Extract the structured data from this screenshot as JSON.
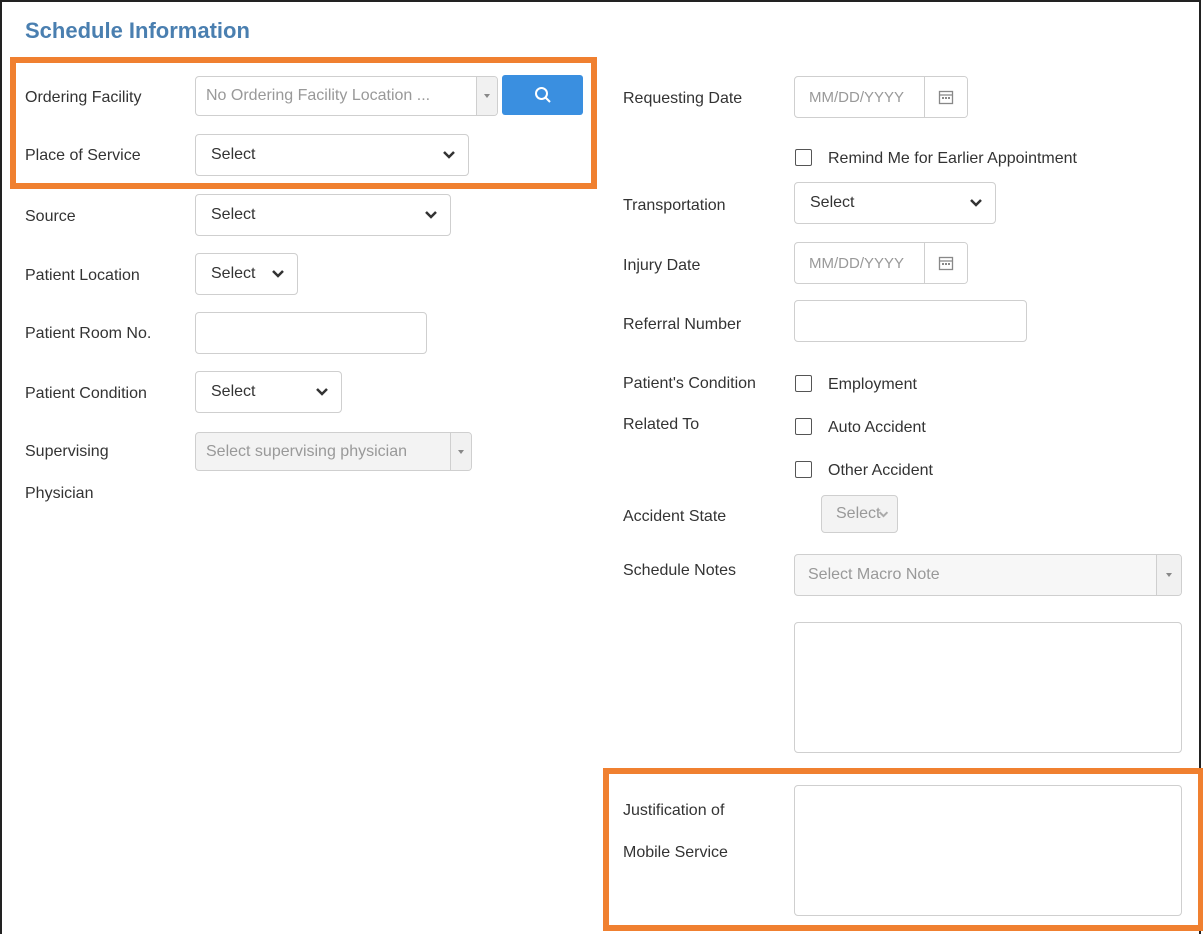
{
  "section": {
    "title": "Schedule Information"
  },
  "left": {
    "ordering_facility": {
      "label": "Ordering Facility",
      "value": "No Ordering Facility Location ..."
    },
    "place_of_service": {
      "label": "Place of Service",
      "value": "Select"
    },
    "source": {
      "label": "Source",
      "value": "Select"
    },
    "patient_location": {
      "label": "Patient Location",
      "value": "Select"
    },
    "patient_room": {
      "label": "Patient Room No.",
      "value": ""
    },
    "patient_condition": {
      "label": "Patient Condition",
      "value": "Select"
    },
    "supervising_physician": {
      "label_line1": "Supervising",
      "label_line2": "Physician",
      "placeholder": "Select supervising physician"
    }
  },
  "right": {
    "requesting_date": {
      "label": "Requesting Date",
      "placeholder": "MM/DD/YYYY"
    },
    "remind_me": {
      "label": "Remind Me for Earlier Appointment",
      "checked": false
    },
    "transportation": {
      "label": "Transportation",
      "value": "Select"
    },
    "injury_date": {
      "label": "Injury Date",
      "placeholder": "MM/DD/YYYY"
    },
    "referral_number": {
      "label": "Referral Number",
      "value": ""
    },
    "condition_related": {
      "label_line1": "Patient's Condition",
      "label_line2": "Related To",
      "options": [
        {
          "label": "Employment",
          "checked": false
        },
        {
          "label": "Auto Accident",
          "checked": false
        },
        {
          "label": "Other Accident",
          "checked": false
        }
      ]
    },
    "accident_state": {
      "label": "Accident State",
      "value": "Select"
    },
    "schedule_notes": {
      "label": "Schedule Notes",
      "placeholder": "Select Macro Note",
      "text": ""
    },
    "justification": {
      "label_line1": "Justification of",
      "label_line2": "Mobile Service",
      "text": ""
    }
  },
  "colors": {
    "highlight": "#f08030",
    "title": "#4a7fb0",
    "search_button": "#3a8fe0"
  },
  "icons": {
    "search": "search-icon",
    "calendar": "calendar-icon",
    "caret": "chevron-down-icon",
    "dropdown": "triangle-down-icon"
  }
}
